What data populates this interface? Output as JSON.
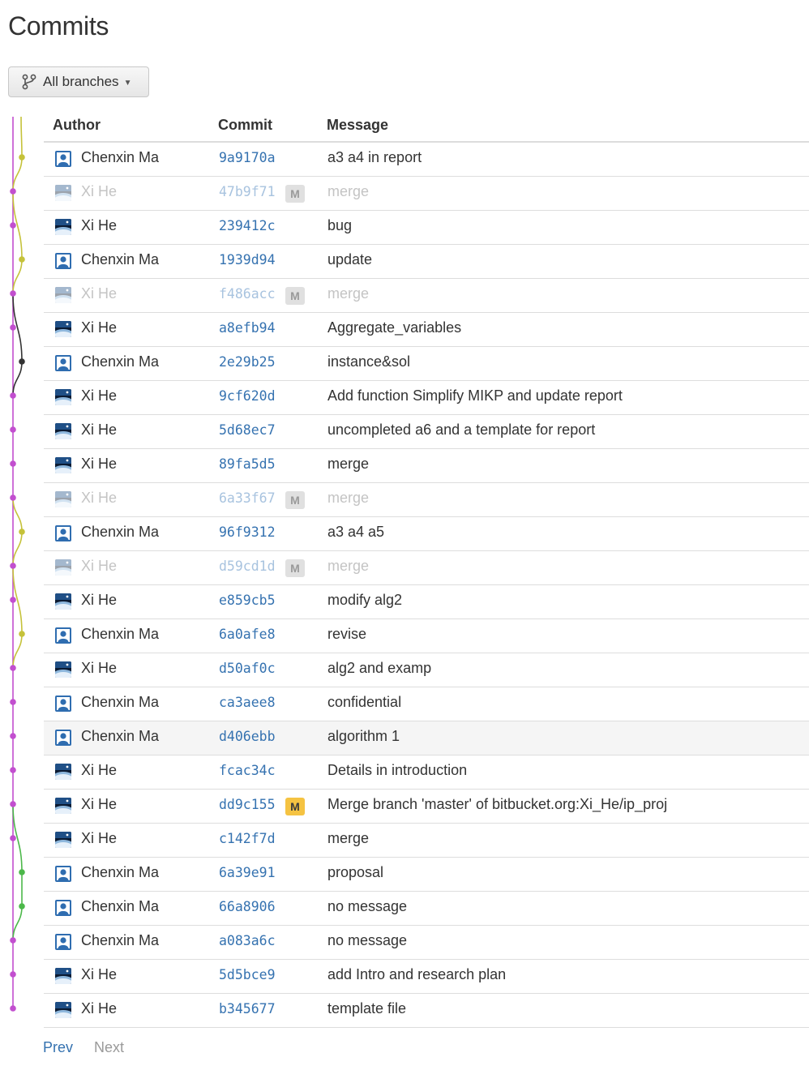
{
  "page": {
    "title": "Commits"
  },
  "branch_filter": {
    "label": "All branches"
  },
  "table": {
    "headers": {
      "author": "Author",
      "commit": "Commit",
      "message": "Message"
    },
    "rows": [
      {
        "author": "Chenxin Ma",
        "avatar": "user-default-icon",
        "hash": "9a9170a",
        "merge": "",
        "message": "a3 a4 in report",
        "faded": false
      },
      {
        "author": "Xi He",
        "avatar": "earth-photo-icon",
        "hash": "47b9f71",
        "merge": "M",
        "merge_style": "grey",
        "message": "merge",
        "faded": true
      },
      {
        "author": "Xi He",
        "avatar": "earth-photo-icon",
        "hash": "239412c",
        "merge": "",
        "message": "bug",
        "faded": false
      },
      {
        "author": "Chenxin Ma",
        "avatar": "user-default-icon",
        "hash": "1939d94",
        "merge": "",
        "message": "update",
        "faded": false
      },
      {
        "author": "Xi He",
        "avatar": "earth-photo-icon",
        "hash": "f486acc",
        "merge": "M",
        "merge_style": "grey",
        "message": "merge",
        "faded": true
      },
      {
        "author": "Xi He",
        "avatar": "earth-photo-icon",
        "hash": "a8efb94",
        "merge": "",
        "message": "Aggregate_variables",
        "faded": false
      },
      {
        "author": "Chenxin Ma",
        "avatar": "user-default-icon",
        "hash": "2e29b25",
        "merge": "",
        "message": "instance&sol",
        "faded": false
      },
      {
        "author": "Xi He",
        "avatar": "earth-photo-icon",
        "hash": "9cf620d",
        "merge": "",
        "message": "Add function Simplify MIKP and update report",
        "faded": false
      },
      {
        "author": "Xi He",
        "avatar": "earth-photo-icon",
        "hash": "5d68ec7",
        "merge": "",
        "message": "uncompleted a6 and a template for report",
        "faded": false
      },
      {
        "author": "Xi He",
        "avatar": "earth-photo-icon",
        "hash": "89fa5d5",
        "merge": "",
        "message": "merge",
        "faded": false
      },
      {
        "author": "Xi He",
        "avatar": "earth-photo-icon",
        "hash": "6a33f67",
        "merge": "M",
        "merge_style": "grey",
        "message": "merge",
        "faded": true
      },
      {
        "author": "Chenxin Ma",
        "avatar": "user-default-icon",
        "hash": "96f9312",
        "merge": "",
        "message": "a3 a4 a5",
        "faded": false
      },
      {
        "author": "Xi He",
        "avatar": "earth-photo-icon",
        "hash": "d59cd1d",
        "merge": "M",
        "merge_style": "grey",
        "message": "merge",
        "faded": true
      },
      {
        "author": "Xi He",
        "avatar": "earth-photo-icon",
        "hash": "e859cb5",
        "merge": "",
        "message": "modify alg2",
        "faded": false
      },
      {
        "author": "Chenxin Ma",
        "avatar": "user-default-icon",
        "hash": "6a0afe8",
        "merge": "",
        "message": "revise",
        "faded": false
      },
      {
        "author": "Xi He",
        "avatar": "earth-photo-icon",
        "hash": "d50af0c",
        "merge": "",
        "message": "alg2 and examp",
        "faded": false
      },
      {
        "author": "Chenxin Ma",
        "avatar": "user-default-icon",
        "hash": "ca3aee8",
        "merge": "",
        "message": "confidential",
        "faded": false
      },
      {
        "author": "Chenxin Ma",
        "avatar": "user-default-icon",
        "hash": "d406ebb",
        "merge": "",
        "message": "algorithm 1",
        "faded": false,
        "highlight": true
      },
      {
        "author": "Xi He",
        "avatar": "earth-photo-icon",
        "hash": "fcac34c",
        "merge": "",
        "message": "Details in introduction",
        "faded": false
      },
      {
        "author": "Xi He",
        "avatar": "earth-photo-icon",
        "hash": "dd9c155",
        "merge": "M",
        "merge_style": "yellow",
        "message": "Merge branch 'master' of bitbucket.org:Xi_He/ip_proj",
        "faded": false
      },
      {
        "author": "Xi He",
        "avatar": "earth-photo-icon",
        "hash": "c142f7d",
        "merge": "",
        "message": "merge",
        "faded": false
      },
      {
        "author": "Chenxin Ma",
        "avatar": "user-default-icon",
        "hash": "6a39e91",
        "merge": "",
        "message": "proposal",
        "faded": false
      },
      {
        "author": "Chenxin Ma",
        "avatar": "user-default-icon",
        "hash": "66a8906",
        "merge": "",
        "message": "no message",
        "faded": false
      },
      {
        "author": "Chenxin Ma",
        "avatar": "user-default-icon",
        "hash": "a083a6c",
        "merge": "",
        "message": "no message",
        "faded": false
      },
      {
        "author": "Xi He",
        "avatar": "earth-photo-icon",
        "hash": "5d5bce9",
        "merge": "",
        "message": "add Intro and research plan",
        "faded": false
      },
      {
        "author": "Xi He",
        "avatar": "earth-photo-icon",
        "hash": "b345677",
        "merge": "",
        "message": "template file",
        "faded": false
      }
    ]
  },
  "pagination": {
    "prev": "Prev",
    "next": "Next"
  },
  "colors": {
    "link": "#3572b0",
    "graph_magenta": "#c24fcf",
    "graph_olive": "#c5c23a",
    "graph_dark": "#333333",
    "graph_green": "#4cb84a",
    "merge_badge": "#f5c342"
  }
}
